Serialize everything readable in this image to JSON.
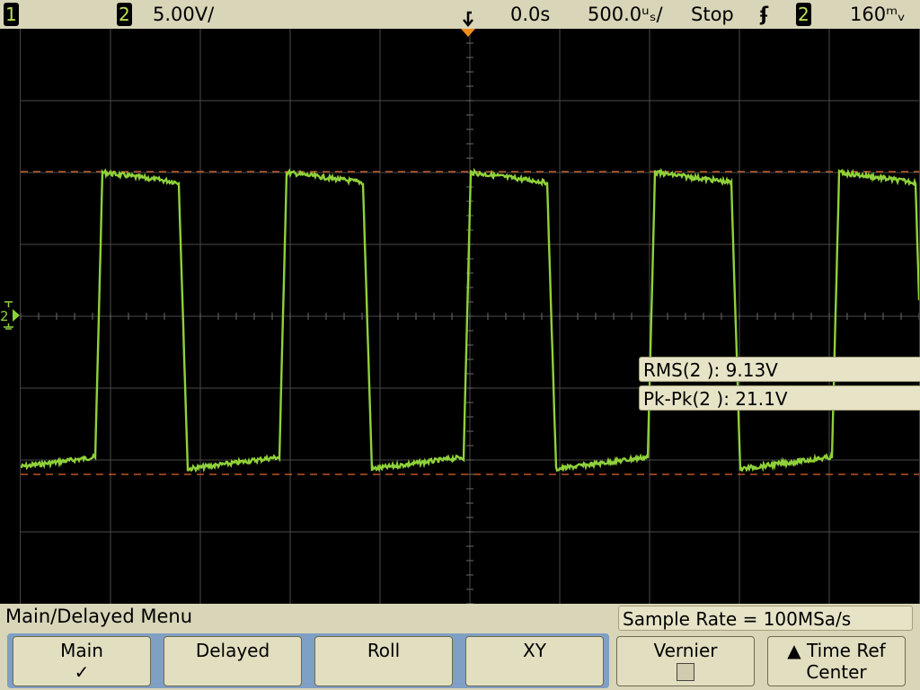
{
  "status": {
    "ch1": "1",
    "ch2": "2",
    "volts_per_div": "5.00V/",
    "time_delay": "0.0s",
    "time_per_div": "500.0ᵘₛ/",
    "run_state": "Stop",
    "trigger_slope": "ʄ",
    "trigger_channel": "2",
    "trigger_level": "160ᵐᵥ"
  },
  "screen": {
    "ground_marker": "2",
    "trace_color": "#8fd13a",
    "cursor_color": "#e0632a"
  },
  "measurements": [
    {
      "text": "RMS(2 ): 9.13V"
    },
    {
      "text": "Pk-Pk(2 ): 21.1V"
    }
  ],
  "menu": {
    "title": "Main/Delayed Menu",
    "sample_rate": "Sample Rate = 100MSa/s",
    "softkeys": [
      {
        "label": "Main",
        "sub": "✓"
      },
      {
        "label": "Delayed",
        "sub": ""
      },
      {
        "label": "Roll",
        "sub": ""
      },
      {
        "label": "XY",
        "sub": ""
      },
      {
        "label": "Vernier",
        "sub": ""
      },
      {
        "label": "▲ Time Ref",
        "sub": "Center"
      }
    ]
  }
}
